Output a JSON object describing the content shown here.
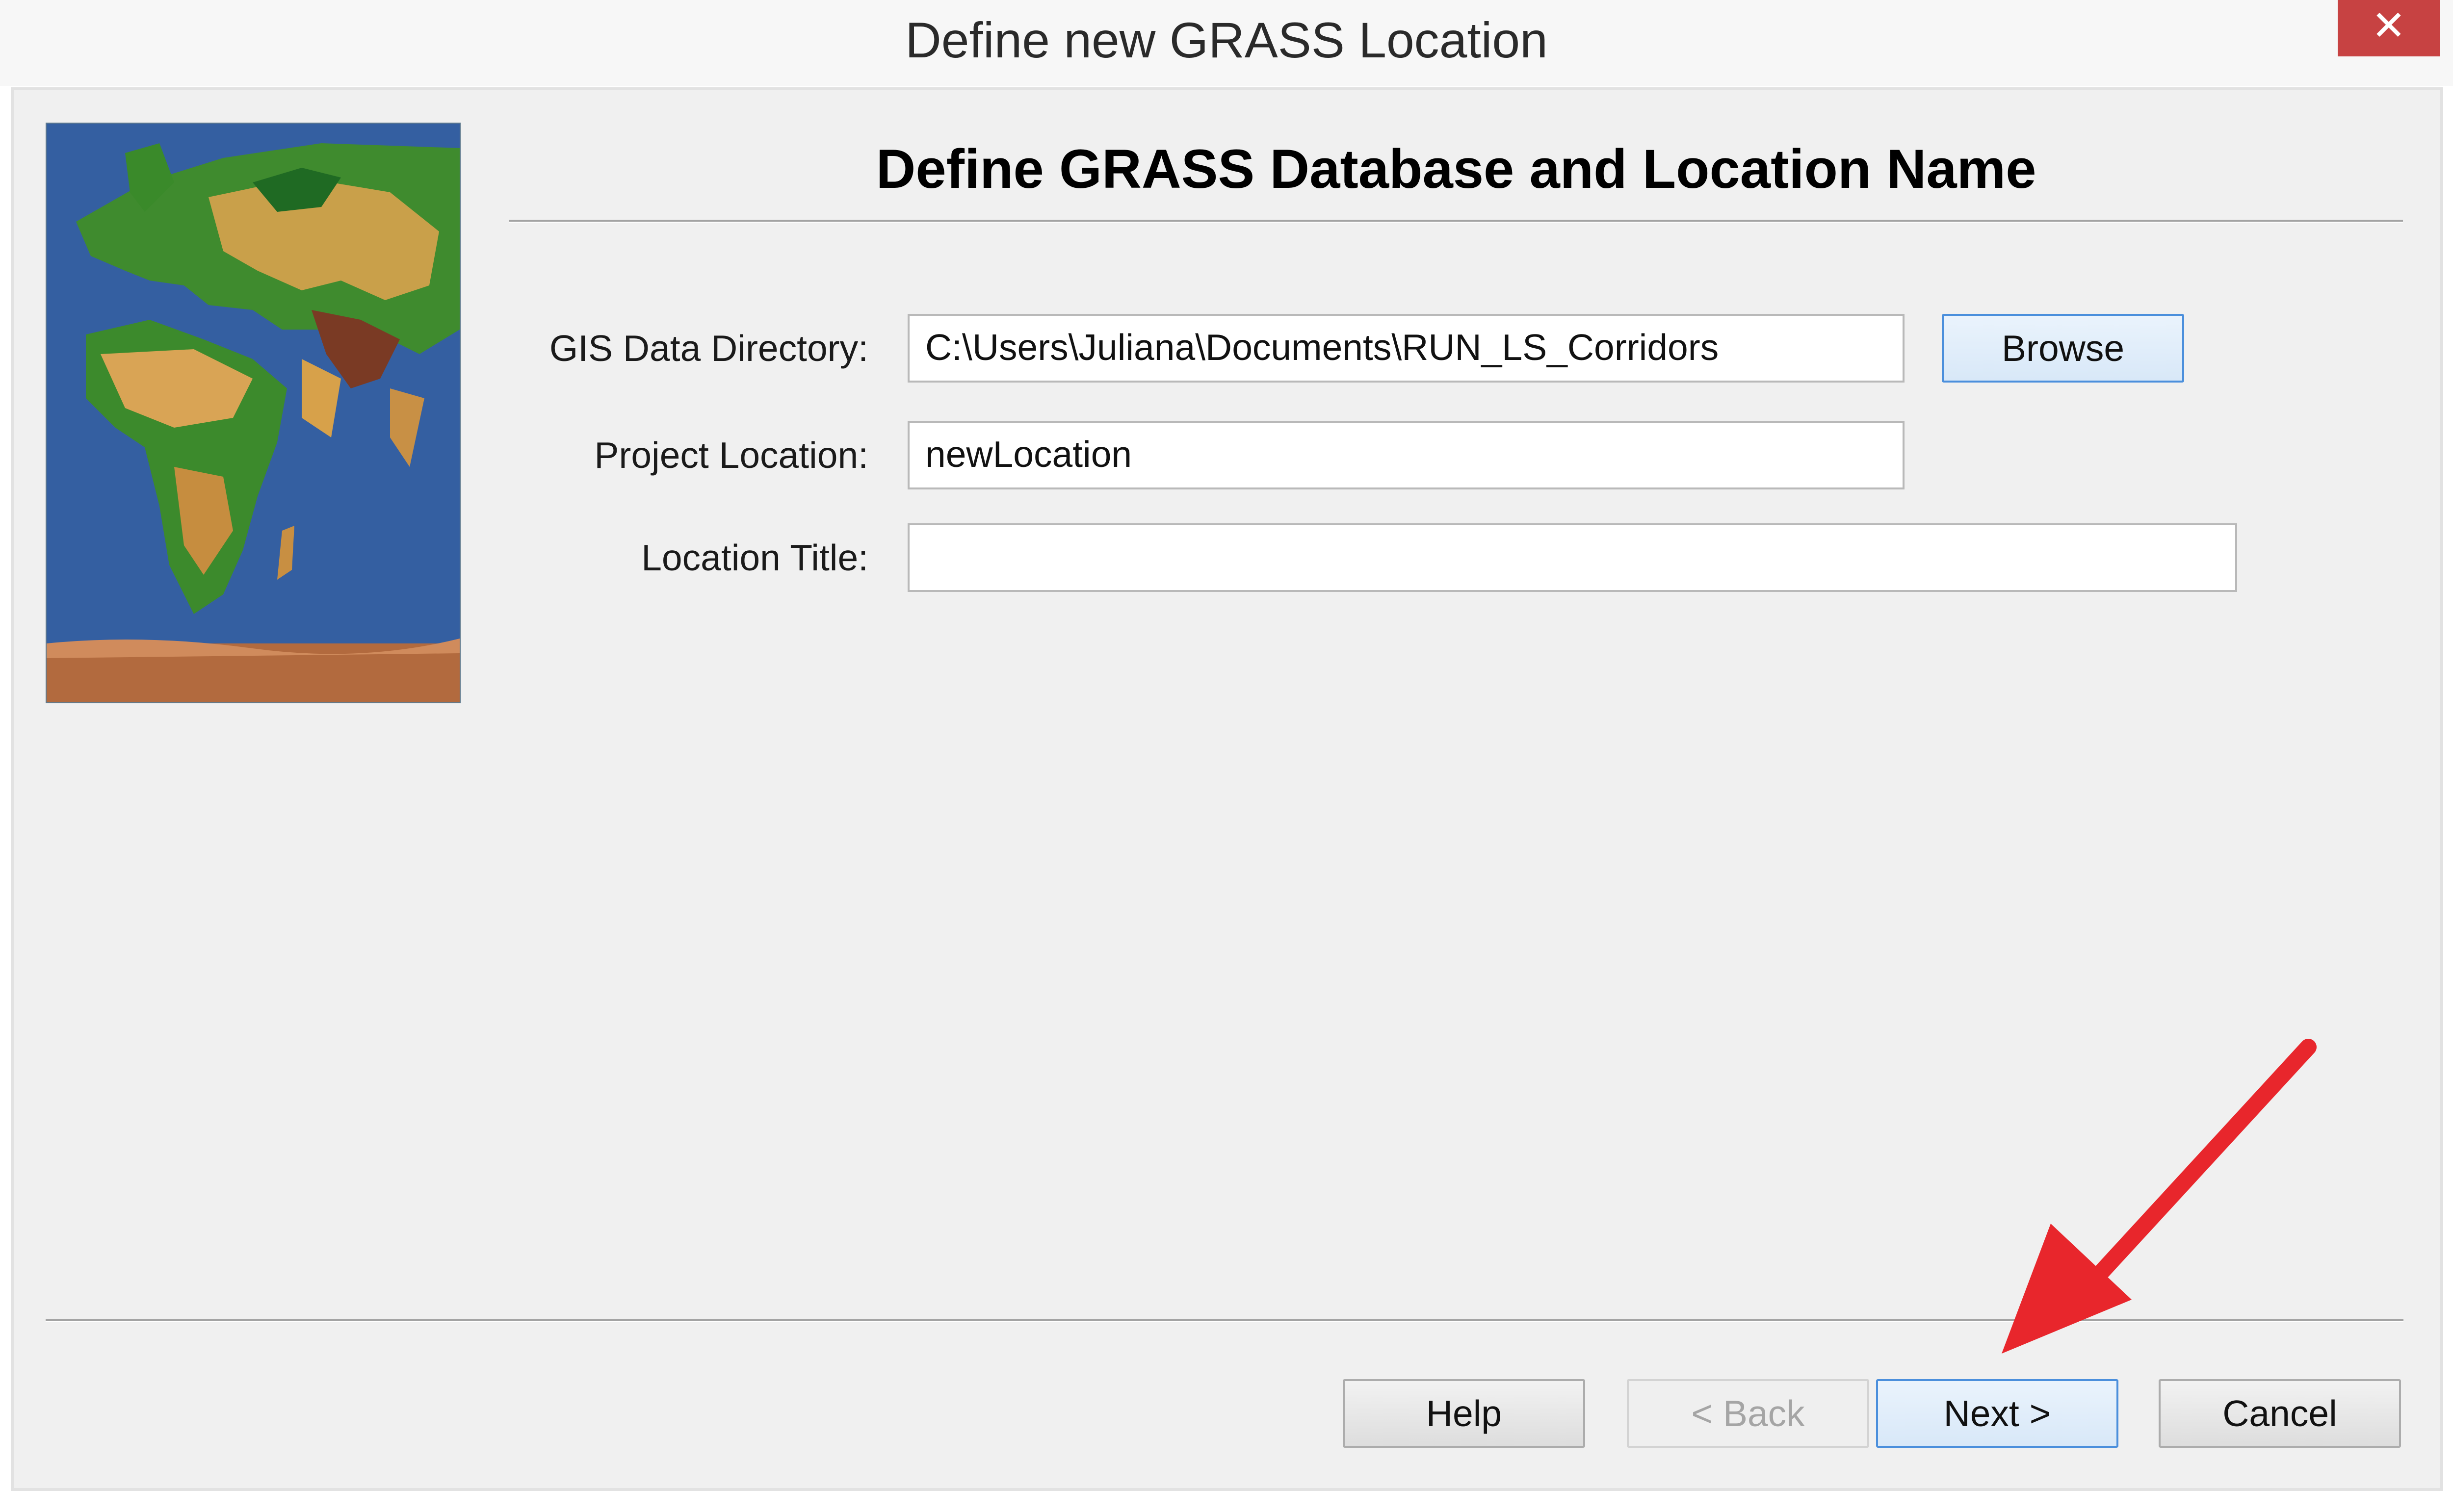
{
  "window": {
    "title": "Define new GRASS Location",
    "close_glyph": "✕"
  },
  "page": {
    "heading": "Define GRASS Database and Location Name"
  },
  "form": {
    "gis_dir_label": "GIS Data Directory:",
    "gis_dir_value": "C:\\Users\\Juliana\\Documents\\RUN_LS_Corridors",
    "browse_label": "Browse",
    "location_label": "Project Location:",
    "location_value": "newLocation",
    "title_label": "Location Title:",
    "title_value": ""
  },
  "buttons": {
    "help": "Help",
    "back": "< Back",
    "next": "Next >",
    "cancel": "Cancel"
  },
  "colors": {
    "close_button": "#c74242",
    "focus_border": "#4b8fdc",
    "annotation_arrow": "#e8262c"
  },
  "icons": {
    "sidebar_image": "world-relief-map",
    "annotation": "red-arrow-pointing-to-next"
  }
}
